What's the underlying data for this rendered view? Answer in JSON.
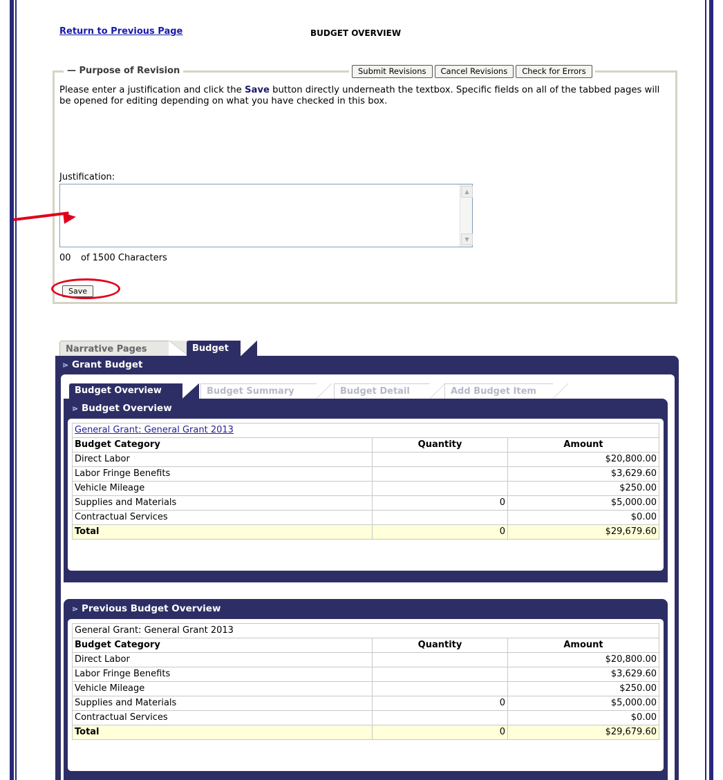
{
  "header": {
    "return_link": "Return to Previous Page",
    "title": "BUDGET OVERVIEW"
  },
  "revision": {
    "legend": "Purpose of Revision",
    "buttons": {
      "submit": "Submit Revisions",
      "cancel": "Cancel Revisions",
      "check": "Check for Errors"
    },
    "instructions_before": "Please enter a justification and click the ",
    "instructions_bold": "Save",
    "instructions_after": " button directly underneath the textbox. Specific fields on all of the tabbed pages will be opened for editing depending on what you have checked in this box.",
    "justification_label": "Justification:",
    "justification_value": "",
    "char_count": "00",
    "char_limit_text": "of 1500 Characters",
    "save_label": "Save"
  },
  "tabs": {
    "narrative": "Narrative Pages",
    "budget": "Budget"
  },
  "grant_budget_title": "Grant Budget",
  "budget_tabs": {
    "overview": "Budget Overview",
    "summary": "Budget Summary",
    "detail": "Budget Detail",
    "add": "Add Budget Item"
  },
  "current": {
    "title": "Budget Overview",
    "caption": "General Grant: General Grant 2013",
    "headers": [
      "Budget Category",
      "Quantity",
      "Amount"
    ],
    "rows": [
      [
        "Direct Labor",
        "",
        "$20,800.00"
      ],
      [
        "Labor Fringe Benefits",
        "",
        "$3,629.60"
      ],
      [
        "Vehicle Mileage",
        "",
        "$250.00"
      ],
      [
        "Supplies and Materials",
        "0",
        "$5,000.00"
      ],
      [
        "Contractual Services",
        "",
        "$0.00"
      ]
    ],
    "total": [
      "Total",
      "0",
      "$29,679.60"
    ]
  },
  "previous": {
    "title": "Previous Budget Overview",
    "caption": "General Grant: General Grant 2013",
    "headers": [
      "Budget Category",
      "Quantity",
      "Amount"
    ],
    "rows": [
      [
        "Direct Labor",
        "",
        "$20,800.00"
      ],
      [
        "Labor Fringe Benefits",
        "",
        "$3,629.60"
      ],
      [
        "Vehicle Mileage",
        "",
        "$250.00"
      ],
      [
        "Supplies and Materials",
        "0",
        "$5,000.00"
      ],
      [
        "Contractual Services",
        "",
        "$0.00"
      ]
    ],
    "total": [
      "Total",
      "0",
      "$29,679.60"
    ]
  },
  "colors": {
    "panel": "#2e2e66",
    "annotation": "#e0001b",
    "total_row": "#ffffd9"
  }
}
